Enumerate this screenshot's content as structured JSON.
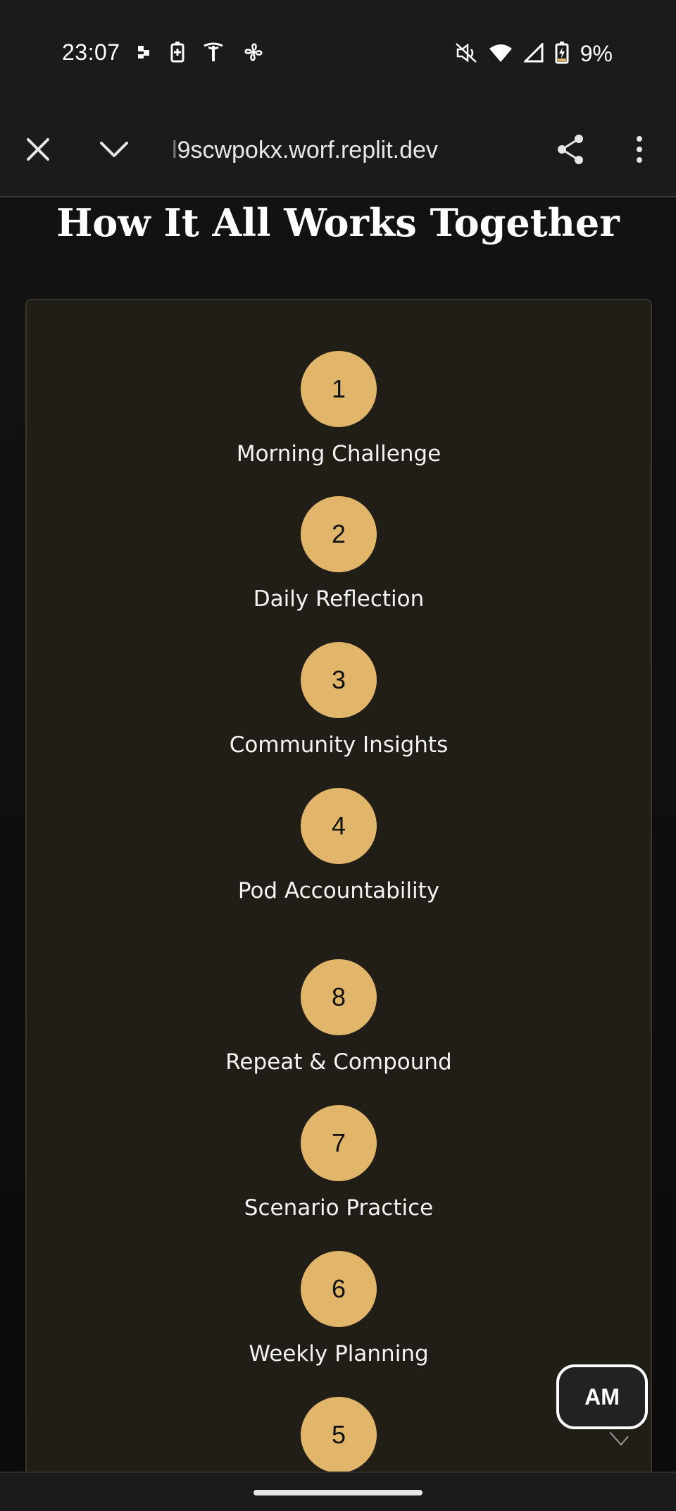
{
  "status_bar": {
    "time": "23:07",
    "battery_percent": "9%",
    "left_icons": [
      "notification-dots-icon",
      "battery-saver-icon",
      "tesla-icon",
      "fan-icon"
    ],
    "right_icons": [
      "mute-icon",
      "wifi-icon",
      "signal-icon",
      "battery-charging-icon"
    ]
  },
  "browser": {
    "url_prefix": "l",
    "url": "9scwpokx.worf.replit.dev"
  },
  "page": {
    "title": "How It All Works Together"
  },
  "steps": [
    {
      "number": "1",
      "label": "Morning Challenge"
    },
    {
      "number": "2",
      "label": "Daily Reflection"
    },
    {
      "number": "3",
      "label": "Community Insights"
    },
    {
      "number": "4",
      "label": "Pod Accountability"
    },
    {
      "number": "8",
      "label": "Repeat & Compound"
    },
    {
      "number": "7",
      "label": "Scenario Practice"
    },
    {
      "number": "6",
      "label": "Weekly Planning"
    },
    {
      "number": "5",
      "label": ""
    }
  ],
  "floating_badge": {
    "initials": "AM"
  },
  "colors": {
    "accent": "#e2b66a",
    "card_background": "#211d17",
    "page_background": "#0b0b0b"
  }
}
